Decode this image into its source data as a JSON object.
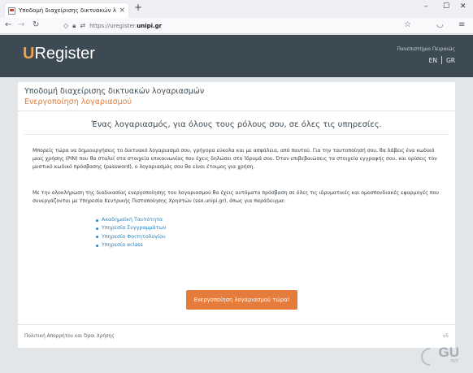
{
  "browser": {
    "tab_title": "Υποδομή διαχείρισης δικτυακών λογαριασμών",
    "tab_close": "×",
    "new_tab": "+",
    "window_controls": {
      "minimize": "–",
      "maximize": "☐",
      "close": "✕"
    },
    "url_prefix": "https://uregister.",
    "url_host": "unipi.gr",
    "icons": [
      "back-icon",
      "forward-icon",
      "reload-icon",
      "shield-icon",
      "lock-icon",
      "permissions-icon",
      "star-icon",
      "pocket-icon",
      "menu-icon"
    ]
  },
  "header": {
    "logo_u": "U",
    "logo_rest": "Register",
    "university": "Πανεπιστήμιο Πειραιώς",
    "languages": [
      "EN",
      "GR"
    ],
    "background": "#3b4a53",
    "accent": "#f0a04b"
  },
  "card": {
    "title": "Υποδομή διαχείρισης δικτυακών λογαριασμών",
    "subtitle": "Ενεργοποίηση λογαριασμού",
    "tagline": "Ένας λογαριασμός, για όλους τους ρόλους σου, σε όλες τις υπηρεσίες.",
    "paragraph1": "Μπορείς τώρα να δημιουργήσεις το δικτυακό λογαριασμό σου, γρήγορα εύκολα και με ασφάλεια, από παντού. Για την ταυτοποίησή σου, θα λάβεις ένα κωδικό μιας χρήσης (PIN) που θα σταλεί στα στοιχεία επικοινωνίας που έχεις δηλώσει στο Ίδρυμά σου. Όταν επιβεβαιώσεις τα στοιχεία εγγραφής σου, και ορίσεις τον μυστικό κωδικό πρόσβασης (password), ο λογαριασμός σου θα είναι έτοιμος για χρήση.",
    "paragraph2": "Με την ολοκλήρωση της διαδικασίας ενεργοποίησης του λογαριασμού θα έχεις αυτόματα πρόσβαση σε όλες τις ιδρυματικές και ομοσπονδιακές εφαρμογές που συνεργάζονται με Υπηρεσία Κεντρικής Πιστοποίησης Χρηστών (sso.unipi.gr), όπως για παράδειγμα:",
    "services": [
      "Ακαδημαϊκή Ταυτότητα",
      "Υπηρεσία Συγγραμμάτων",
      "Υπηρεσία Φοιτητολογίου",
      "Υπηρεσία eclass"
    ],
    "button_label": "Ενεργοποίηση λογαριασμού τώρα!",
    "footer_link": "Πολιτική Απορρήτου και Όροι Χρήσης",
    "version": "v5",
    "accent": "#e57c3b",
    "link_color": "#2a7fb8"
  },
  "footer_logo": {
    "main": "GU",
    "sub": "net"
  }
}
